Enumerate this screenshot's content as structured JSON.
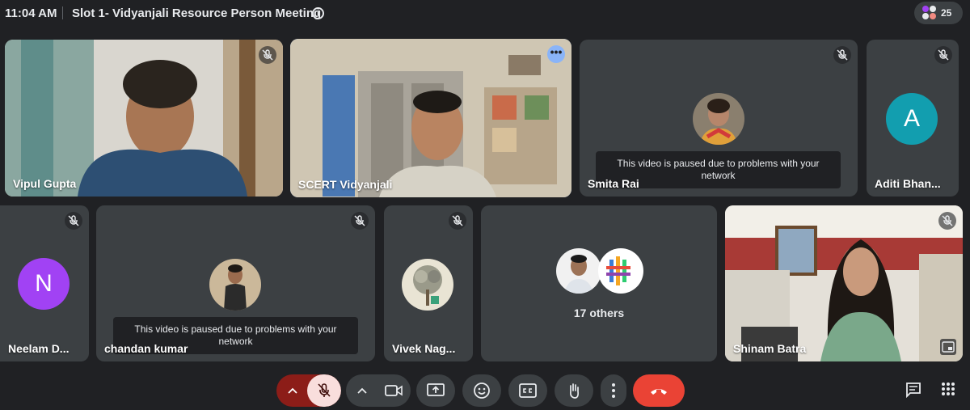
{
  "meeting": {
    "time": "11:04 AM",
    "title": "Slot 1- Vidyanjali Resource Person Meeting",
    "info_icon": "i",
    "people_count": "25"
  },
  "participants": [
    {
      "name": "Vipul Gupta",
      "type": "video",
      "muted": true
    },
    {
      "name": "SCERT Vidyanjali",
      "type": "video",
      "speaking": true,
      "more": "•••"
    },
    {
      "name": "Smita Rai",
      "type": "photo",
      "muted": true,
      "paused_message": "This video is paused due to problems with your network"
    },
    {
      "name": "Aditi Bhan...",
      "type": "letter",
      "letter": "A",
      "color": "#129eaf",
      "muted": true
    },
    {
      "name": "Neelam D...",
      "type": "letter",
      "letter": "N",
      "color": "#a142f4",
      "muted": true
    },
    {
      "name": "chandan kumar",
      "type": "photo",
      "muted": true,
      "paused_message": "This video is paused due to problems with your network"
    },
    {
      "name": "Vivek Nag...",
      "type": "photo",
      "muted": true
    },
    {
      "name": "Shinam Batra",
      "type": "video",
      "muted": true
    }
  ],
  "others": {
    "label": "17 others"
  },
  "colors": {
    "background": "#202124",
    "tile": "#3c4043",
    "mic_off": "#8c1d18",
    "end_call": "#ea4335",
    "speaking_outline": "#8ab4f8"
  },
  "icons": [
    "info-icon",
    "people-icon",
    "mic-off-icon",
    "camera-icon",
    "present-icon",
    "emoji-icon",
    "captions-icon",
    "raise-hand-icon",
    "more-options-icon",
    "end-call-icon",
    "chat-icon",
    "activities-icon",
    "chevron-up-icon",
    "pip-icon"
  ]
}
